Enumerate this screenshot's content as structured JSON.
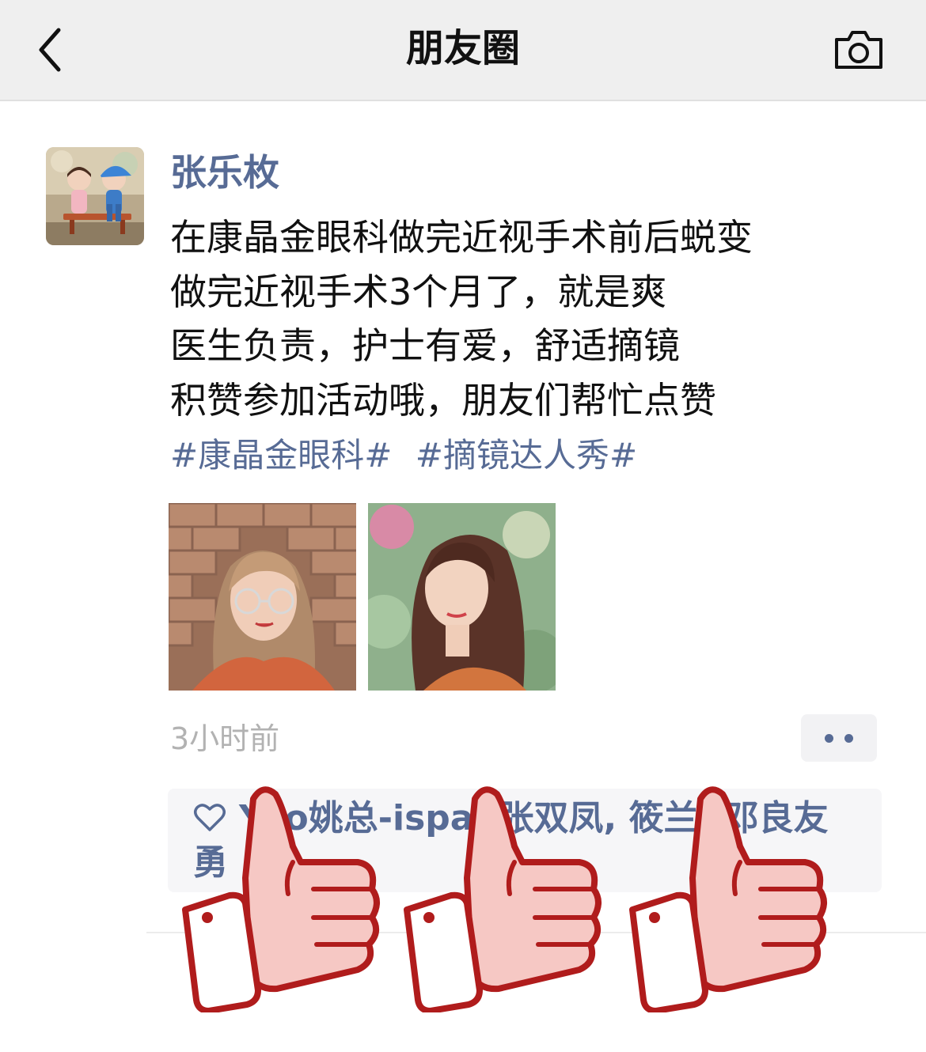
{
  "nav": {
    "title": "朋友圈"
  },
  "post": {
    "username": "张乐枚",
    "lines": [
      "在康晶金眼科做完近视手术前后蜕变",
      "做完近视手术3个月了，就是爽",
      "医生负责，护士有爱，舒适摘镜",
      "积赞参加活动哦，朋友们帮忙点赞"
    ],
    "hashtags": [
      "#康晶金眼科#",
      "#摘镜达人秀#"
    ],
    "time": "3小时前",
    "likes": {
      "names": [
        "Yao姚总-ispa",
        "张双凤",
        "筱兰",
        "邓良友",
        "勇"
      ]
    }
  },
  "colors": {
    "link": "#576b95",
    "thumb_fill": "#f6c8c4",
    "thumb_stroke": "#b01c1c"
  },
  "icons": {
    "back": "chevron-left-icon",
    "camera": "camera-icon",
    "heart": "heart-outline-icon",
    "more": "more-dots-icon",
    "sticker": "thumbs-up-icon"
  }
}
